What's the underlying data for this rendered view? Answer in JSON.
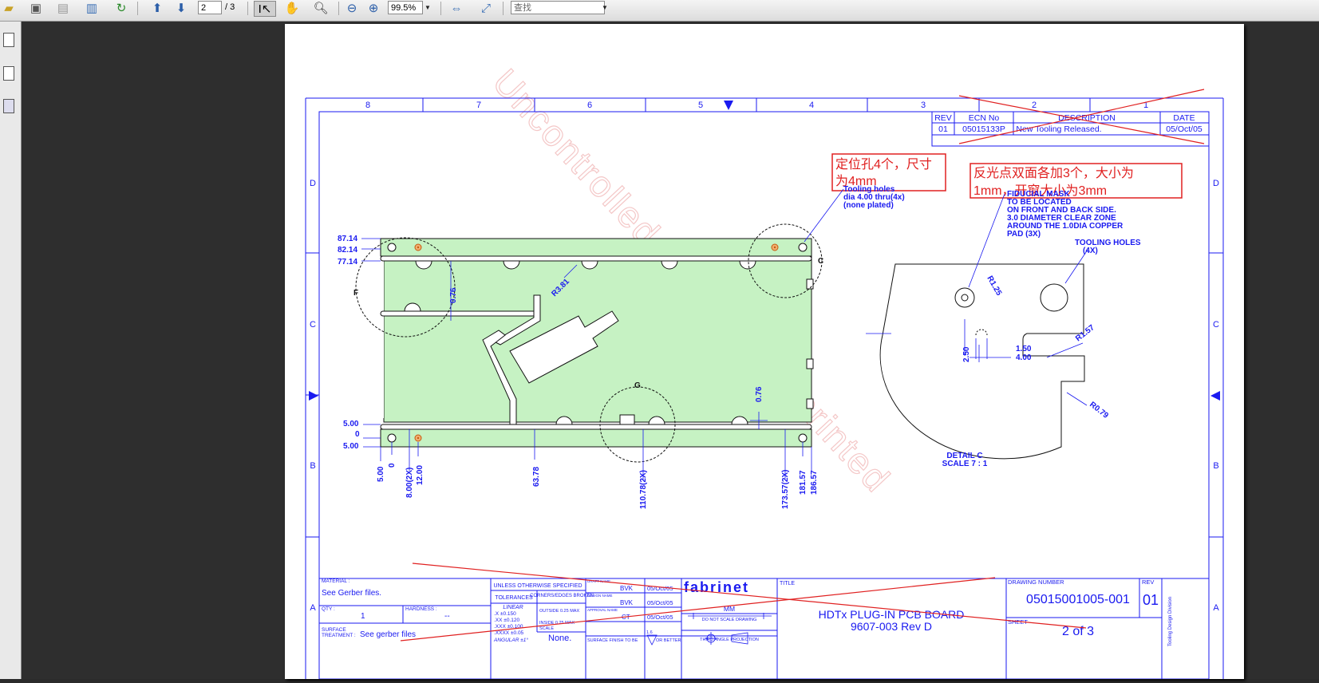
{
  "toolbar": {
    "page_current": "2",
    "page_total": "/ 3",
    "zoom": "99.5%",
    "find_placeholder": "查找"
  },
  "drawing": {
    "watermark": "Uncontrolled copy when printed",
    "zone_numbers_top": [
      "8",
      "7",
      "6",
      "5",
      "4",
      "3",
      "2",
      "1"
    ],
    "zone_letters": [
      "D",
      "C",
      "B",
      "A"
    ],
    "revision_table": {
      "headers": [
        "REV",
        "ECN No",
        "DESCRIPTION",
        "DATE"
      ],
      "row": [
        "01",
        "05015133P",
        "New Tooling Released.",
        "05/Oct/05"
      ]
    },
    "annotation_cn_1": "定位孔4个，尺寸为4mm",
    "annotation_cn_1_line1": "定位孔4个，尺寸",
    "annotation_cn_1_line2": "为4mm",
    "annotation_cn_2_line1": "反光点双面各加3个，大小为",
    "annotation_cn_2_line2": "1mm，开窗大小为3mm",
    "note_tooling_holes": [
      "Tooling holes",
      "dia 4.00 thru(4x)",
      "(none plated)"
    ],
    "note_fiducial": [
      "FIDUCIAL MASK",
      "TO BE LOCATED",
      "ON FRONT AND BACK SIDE.",
      "3.0 DIAMETER CLEAR ZONE",
      "AROUND THE  1.0DIA COPPER",
      "PAD (3X)"
    ],
    "note_tooling_holes_detail": [
      "TOOLING HOLES",
      "(4X)"
    ],
    "detail_title": "DETAIL C",
    "detail_scale": "SCALE 7 : 1",
    "left_dims": [
      "87.14",
      "82.14",
      "77.14",
      "5.00",
      "0",
      "5.00"
    ],
    "bottom_dims": [
      "5.00",
      "0",
      "8.00(2X)",
      "12.00",
      "63.78",
      "110.78(2X)",
      "173.57(2X)",
      "181.57",
      "186.57"
    ],
    "inner_dims": [
      "0.76",
      "R3.81",
      "0.76"
    ],
    "detail_dims": [
      "R1.25",
      "R1.57",
      "2.50",
      "1.50",
      "4.00",
      "R0.79"
    ],
    "detail_labels": [
      "F",
      "C",
      "G"
    ],
    "title_block": {
      "material_label": "MATERIAL :",
      "material_value": "See Gerber files.",
      "qty_label": "QTY :",
      "qty_value": "1",
      "hardness_label": "HARDNESS :",
      "hardness_value": "--",
      "surface_label_1": "SURFACE",
      "surface_label_2": "TREATMENT :",
      "surface_value": "See gerber files",
      "unless": "UNLESS OTHERWISE SPECIFIED",
      "tolerances": "TOLERANCES",
      "corners": "CORNERS/EDGES BROKEN",
      "linear": "LINEAR",
      "tol_lines": [
        ".X    ±0.150",
        ".XX   ±0.120",
        ".XXX  ±0.100",
        ".XXXX ±0.05"
      ],
      "angular": "ANGULAR ±1°",
      "outside": "OUTSIDE  0.25 MAX",
      "inside": "INSIDE   0.25 MAX",
      "scale_label": "SCALE",
      "scale_value": "None.",
      "surface_finish": "SURFACE FINISH TO BE",
      "or_better": "OR BETTER",
      "finish_num": "1.6",
      "draft_rows": [
        {
          "role": "DRAFT NAME",
          "name": "BVK",
          "date": "05/Oct/05"
        },
        {
          "role": "DESIGN NAME",
          "name": "BVK",
          "date": "05/Oct/05"
        },
        {
          "role": "APPROVAL NAME",
          "name": "CT",
          "date": "05/Oct/05"
        }
      ],
      "company": "fabrinet",
      "units": "MM",
      "do_not_scale": "DO NOT SCALE DRAWING",
      "projection": "THIRD ANGLE PROJECTION",
      "title_label": "TITLE",
      "title_line1": "HDTx PLUG-IN PCB BOARD",
      "title_line2": "9607-003 Rev D",
      "drawing_number_label": "DRAWING NUMBER",
      "drawing_number": "05015001005-001",
      "rev_label": "REV",
      "rev_value": "01",
      "sheet_label": "SHEET",
      "sheet_value": "2 of 3",
      "division": "Tooling Design Division"
    }
  }
}
